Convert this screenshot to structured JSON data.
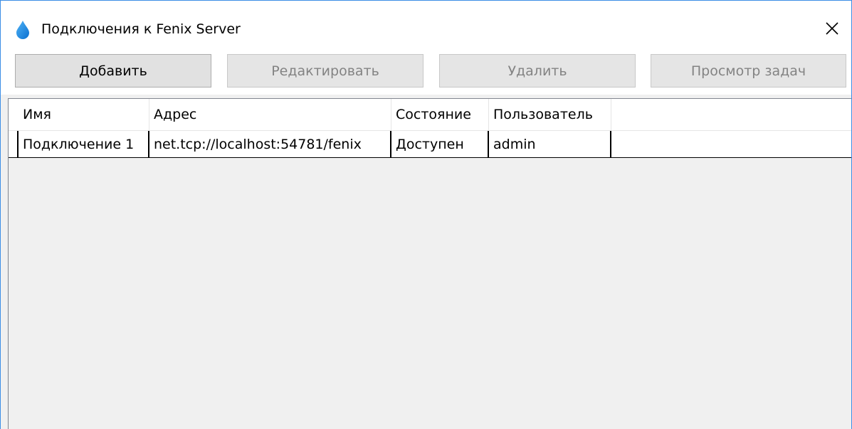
{
  "window": {
    "title": "Подключения к Fenix Server",
    "icon": "water-drop-icon",
    "accent_color": "#3c8ee6"
  },
  "toolbar": {
    "add_label": "Добавить",
    "edit_label": "Редактировать",
    "delete_label": "Удалить",
    "tasks_label": "Просмотр задач"
  },
  "table": {
    "columns": [
      "Имя",
      "Адрес",
      "Состояние",
      "Пользователь"
    ],
    "rows": [
      {
        "name": "Подключение 1",
        "address": "net.tcp://localhost:54781/fenix",
        "state": "Доступен",
        "user": "admin"
      }
    ]
  }
}
